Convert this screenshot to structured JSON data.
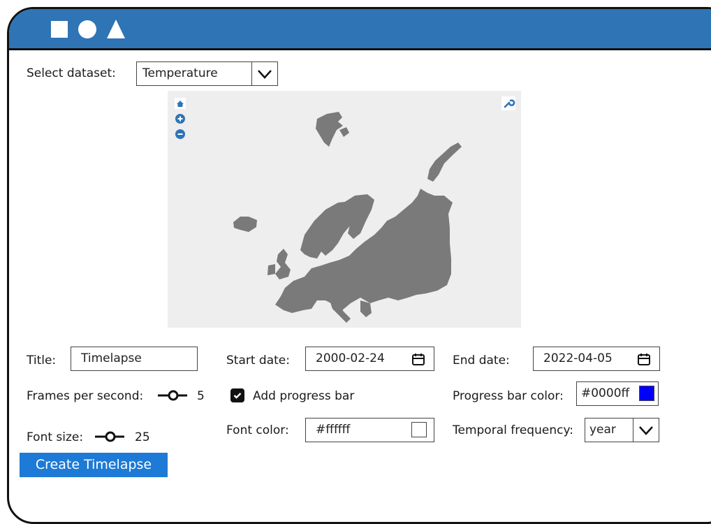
{
  "dataset": {
    "label": "Select dataset:",
    "value": "Temperature"
  },
  "form": {
    "title_label": "Title:",
    "title_value": "Timelapse",
    "start_label": "Start date:",
    "start_value": "2000-02-24",
    "end_label": "End date:",
    "end_value": "2022-04-05",
    "fps_label": "Frames per second:",
    "fps_value": "5",
    "progress_label": "Add progress bar",
    "progress_checked": true,
    "progress_color_label": "Progress bar color:",
    "progress_color_value": "#0000ff",
    "font_size_label": "Font size:",
    "font_size_value": "25",
    "font_color_label": "Font color:",
    "font_color_value": "#ffffff",
    "frequency_label": "Temporal frequency:",
    "frequency_value": "year"
  },
  "create_button": "Create Timelapse",
  "colors": {
    "header": "#2f74b5",
    "button": "#1d7ad6",
    "map_land": "#7a7a7a",
    "map_bg": "#eeeeee",
    "map_control": "#2f74b5"
  },
  "icons": [
    "square-shape-icon",
    "circle-shape-icon",
    "triangle-shape-icon",
    "home-icon",
    "zoom-in-icon",
    "zoom-out-icon",
    "wrench-icon",
    "calendar-icon",
    "chevron-down-icon",
    "checkmark-icon"
  ]
}
